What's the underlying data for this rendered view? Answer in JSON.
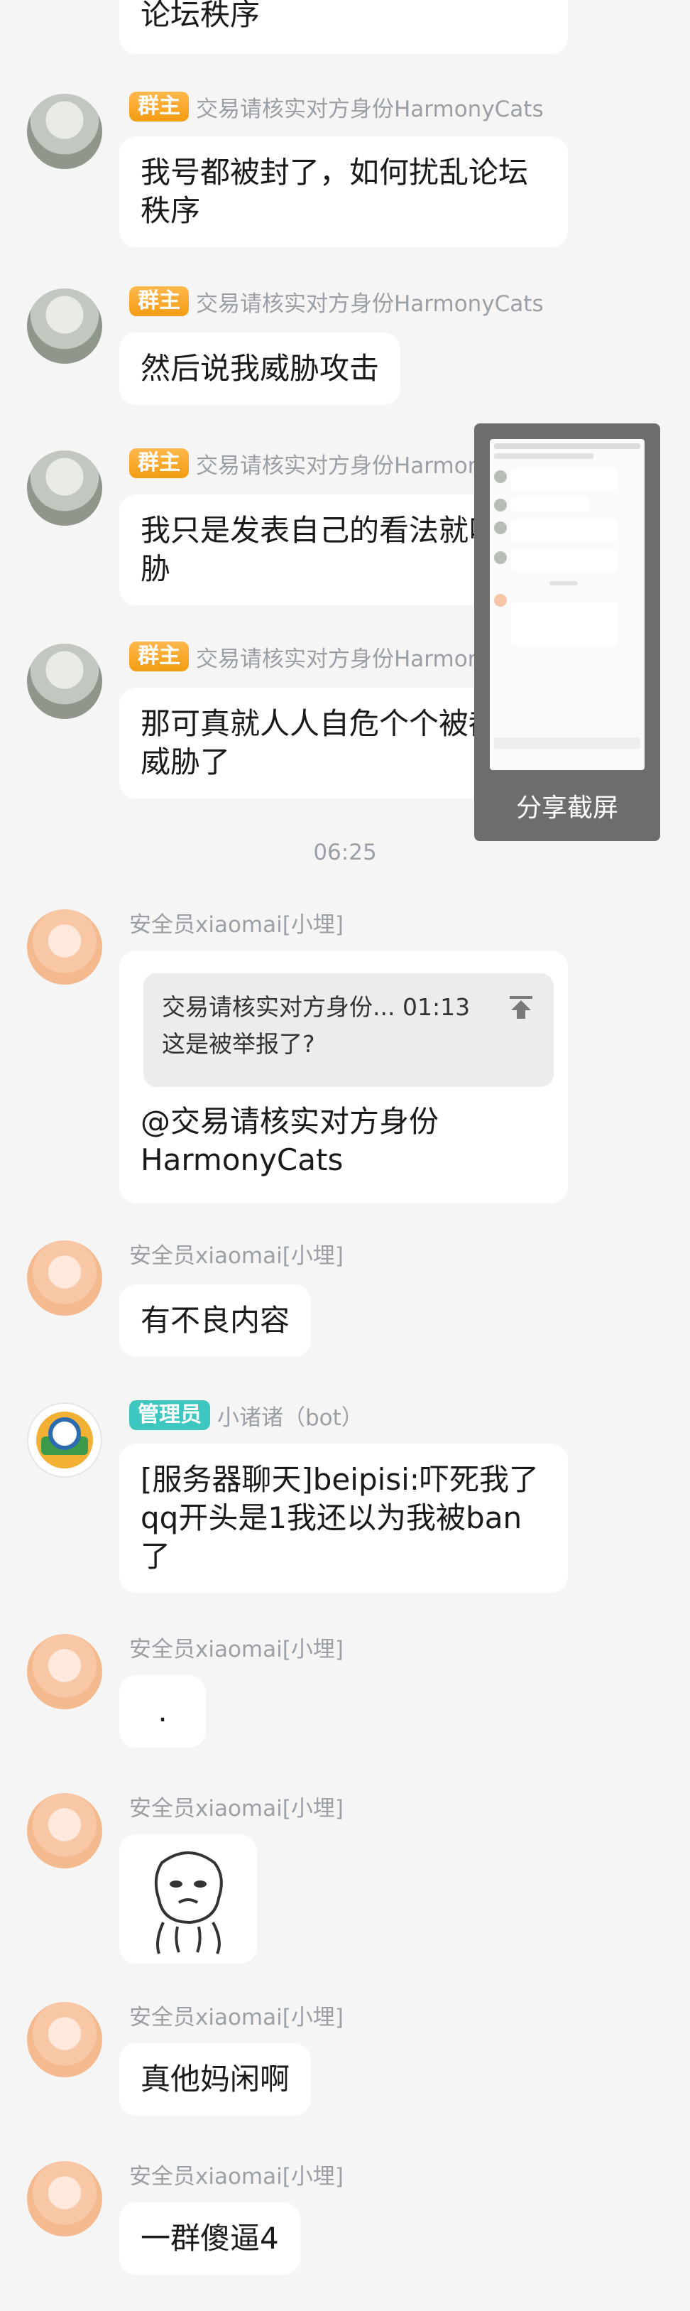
{
  "messages": [
    {
      "id": "m0",
      "text": "论坛秩序"
    },
    {
      "id": "m1",
      "badge": "群主",
      "sender": "交易请核实对方身份HarmonyCats",
      "lines": [
        "我号都被封了，如何扰乱论坛",
        "秩序"
      ]
    },
    {
      "id": "m2",
      "badge": "群主",
      "sender": "交易请核实对方身份HarmonyCats",
      "lines": [
        "然后说我威胁攻击"
      ]
    },
    {
      "id": "m3",
      "badge": "群主",
      "sender": "交易请核实对方身份HarmonyCats",
      "lines": [
        "我只是发表自己的看法就叫威",
        "胁"
      ]
    },
    {
      "id": "m4",
      "badge": "群主",
      "sender": "交易请核实对方身份HarmonyCats",
      "lines": [
        "那可真就人人自危个个被都被",
        "威胁了"
      ]
    },
    {
      "id": "m5",
      "sender": "安全员xiaomai[小埋]",
      "quote": {
        "header": "交易请核实对方身份... 01:13",
        "text": "这是被举报了?"
      },
      "lines": [
        "@交易请核实对方身份",
        "HarmonyCats"
      ]
    },
    {
      "id": "m6",
      "sender": "安全员xiaomai[小埋]",
      "lines": [
        "有不良内容"
      ]
    },
    {
      "id": "m7",
      "badge": "管理员",
      "sender": "小诸诸（bot）",
      "lines": [
        "[服务器聊天]beipisi:吓死我了",
        "qq开头是1我还以为我被ban",
        "了"
      ]
    },
    {
      "id": "m8",
      "sender": "安全员xiaomai[小埋]",
      "lines": [
        "."
      ]
    },
    {
      "id": "m9",
      "sender": "安全员xiaomai[小埋]",
      "sticker": "panda-meme-sticker"
    },
    {
      "id": "m10",
      "sender": "安全员xiaomai[小埋]",
      "lines": [
        "真他妈闲啊"
      ]
    },
    {
      "id": "m11",
      "sender": "安全员xiaomai[小埋]",
      "lines": [
        "一群傻逼4"
      ]
    }
  ],
  "time_divider": "06:25",
  "screenshot_popup": {
    "label": "分享截屏"
  },
  "colors": {
    "background": "#f5f5f5",
    "owner_badge": "#f39c12",
    "admin_badge": "#3ec7c1",
    "bubble": "#ffffff"
  },
  "icons": {
    "pin": "pin-to-top-icon"
  }
}
